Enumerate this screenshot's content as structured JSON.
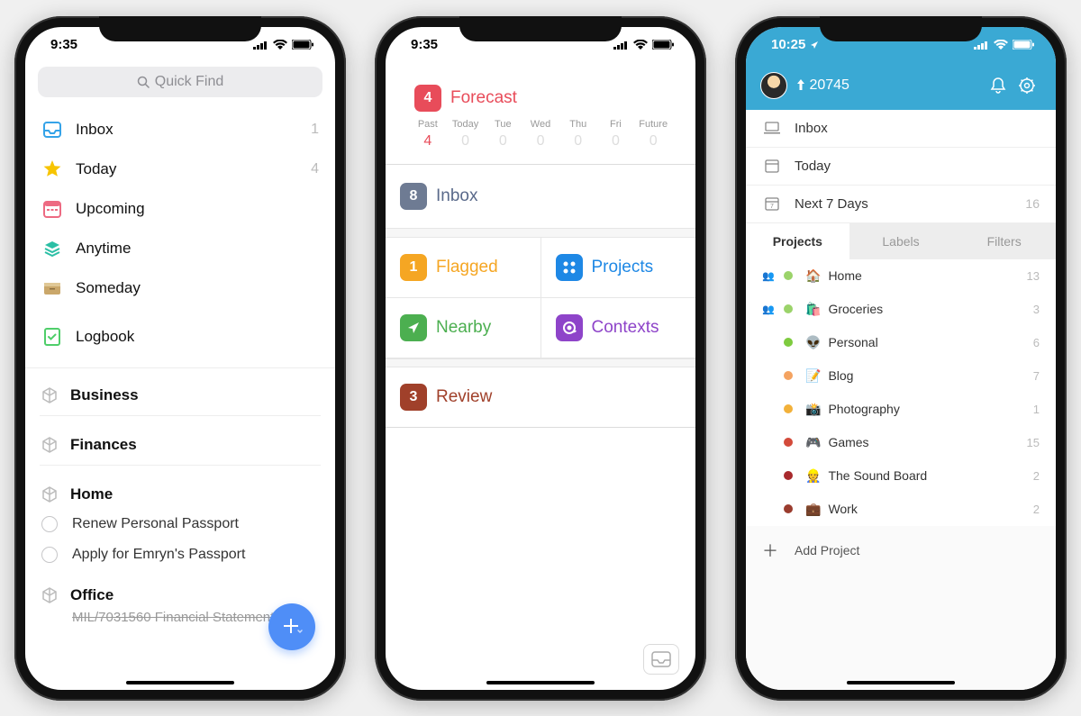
{
  "phone1": {
    "time": "9:35",
    "search_placeholder": "Quick Find",
    "items": [
      {
        "label": "Inbox",
        "count": "1",
        "icon": "inbox",
        "color": "#35a3e8"
      },
      {
        "label": "Today",
        "count": "4",
        "icon": "star",
        "color": "#f7c400"
      },
      {
        "label": "Upcoming",
        "count": "",
        "icon": "calendar",
        "color": "#ed6a82"
      },
      {
        "label": "Anytime",
        "count": "",
        "icon": "stack",
        "color": "#2bbfa5"
      },
      {
        "label": "Someday",
        "count": "",
        "icon": "drawer",
        "color": "#caa76a"
      },
      {
        "label": "Logbook",
        "count": "",
        "icon": "logbook",
        "color": "#4fce6a"
      }
    ],
    "areas": [
      {
        "label": "Business"
      },
      {
        "label": "Finances"
      }
    ],
    "home_label": "Home",
    "tasks": [
      "Renew Personal Passport",
      "Apply for Emryn's Passport"
    ],
    "office_label": "Office",
    "cutoff_task": "MIL/7031560 Financial Statements"
  },
  "phone2": {
    "time": "9:35",
    "forecast": {
      "badge": "4",
      "label": "Forecast",
      "color": "#e84c5a",
      "days": [
        {
          "lbl": "Past",
          "val": "4",
          "hot": true
        },
        {
          "lbl": "Today",
          "val": "0"
        },
        {
          "lbl": "Tue",
          "val": "0"
        },
        {
          "lbl": "Wed",
          "val": "0"
        },
        {
          "lbl": "Thu",
          "val": "0"
        },
        {
          "lbl": "Fri",
          "val": "0"
        },
        {
          "lbl": "Future",
          "val": "0"
        }
      ]
    },
    "inbox": {
      "badge": "8",
      "label": "Inbox",
      "color": "#6e7b93",
      "text": "#59698a"
    },
    "flagged": {
      "badge": "1",
      "label": "Flagged",
      "color": "#f5a623",
      "text": "#f5a623"
    },
    "projects": {
      "label": "Projects",
      "color": "#1e88e5",
      "text": "#1e88e5"
    },
    "nearby": {
      "label": "Nearby",
      "color": "#4caf50",
      "text": "#4caf50"
    },
    "contexts": {
      "label": "Contexts",
      "color": "#8e44c9",
      "text": "#8e44c9"
    },
    "review": {
      "badge": "3",
      "label": "Review",
      "color": "#a0402a",
      "text": "#a0402a"
    }
  },
  "phone3": {
    "time": "10:25",
    "karma": "20745",
    "nav": [
      {
        "label": "Inbox",
        "icon": "laptop",
        "count": ""
      },
      {
        "label": "Today",
        "icon": "calendar-today",
        "count": ""
      },
      {
        "label": "Next 7 Days",
        "icon": "calendar-7",
        "count": "16"
      }
    ],
    "tabs": [
      "Projects",
      "Labels",
      "Filters"
    ],
    "projects": [
      {
        "label": "Home",
        "emoji": "🏠",
        "dot": "#9bd36a",
        "count": "13",
        "shared": true
      },
      {
        "label": "Groceries",
        "emoji": "🛍️",
        "dot": "#9bd36a",
        "count": "3",
        "shared": true
      },
      {
        "label": "Personal",
        "emoji": "👽",
        "dot": "#7ecb3f",
        "count": "6"
      },
      {
        "label": "Blog",
        "emoji": "📝",
        "dot": "#f4a361",
        "count": "7"
      },
      {
        "label": "Photography",
        "emoji": "📸",
        "dot": "#f2b13a",
        "count": "1"
      },
      {
        "label": "Games",
        "emoji": "🎮",
        "dot": "#d34a3a",
        "count": "15"
      },
      {
        "label": "The Sound Board",
        "emoji": "👷",
        "dot": "#a82a2d",
        "count": "2"
      },
      {
        "label": "Work",
        "emoji": "💼",
        "dot": "#9a3c2e",
        "count": "2"
      }
    ],
    "add_label": "Add Project"
  }
}
